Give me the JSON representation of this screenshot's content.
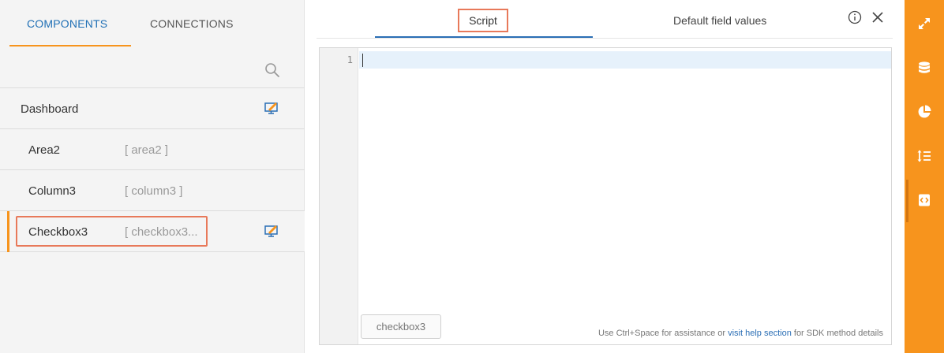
{
  "left_panel": {
    "tabs": [
      "COMPONENTS",
      "CONNECTIONS"
    ],
    "active_tab": "COMPONENTS",
    "items": [
      {
        "name": "Dashboard",
        "tag": ""
      },
      {
        "name": "Area2",
        "tag": "[ area2 ]"
      },
      {
        "name": "Column3",
        "tag": "[ column3 ]"
      },
      {
        "name": "Checkbox3",
        "tag": "[ checkbox3..."
      }
    ]
  },
  "editor_panel": {
    "tabs": [
      "Script",
      "Default field values"
    ],
    "active_tab": "Script",
    "line_numbers": [
      "1"
    ],
    "chip_label": "checkbox3",
    "hint": {
      "prefix": "Use Ctrl+Space for assistance or ",
      "link": "visit help section",
      "suffix": " for SDK method details"
    }
  },
  "right_rail": {
    "buttons": [
      "expand-icon",
      "database-icon",
      "pie-chart-icon",
      "sort-list-icon",
      "script-icon"
    ],
    "accent_color": "#f7941d"
  },
  "colors": {
    "highlight_border": "#e8795a",
    "active_tab_blue": "#2a6eb5",
    "link_blue": "#1f6fb5"
  }
}
